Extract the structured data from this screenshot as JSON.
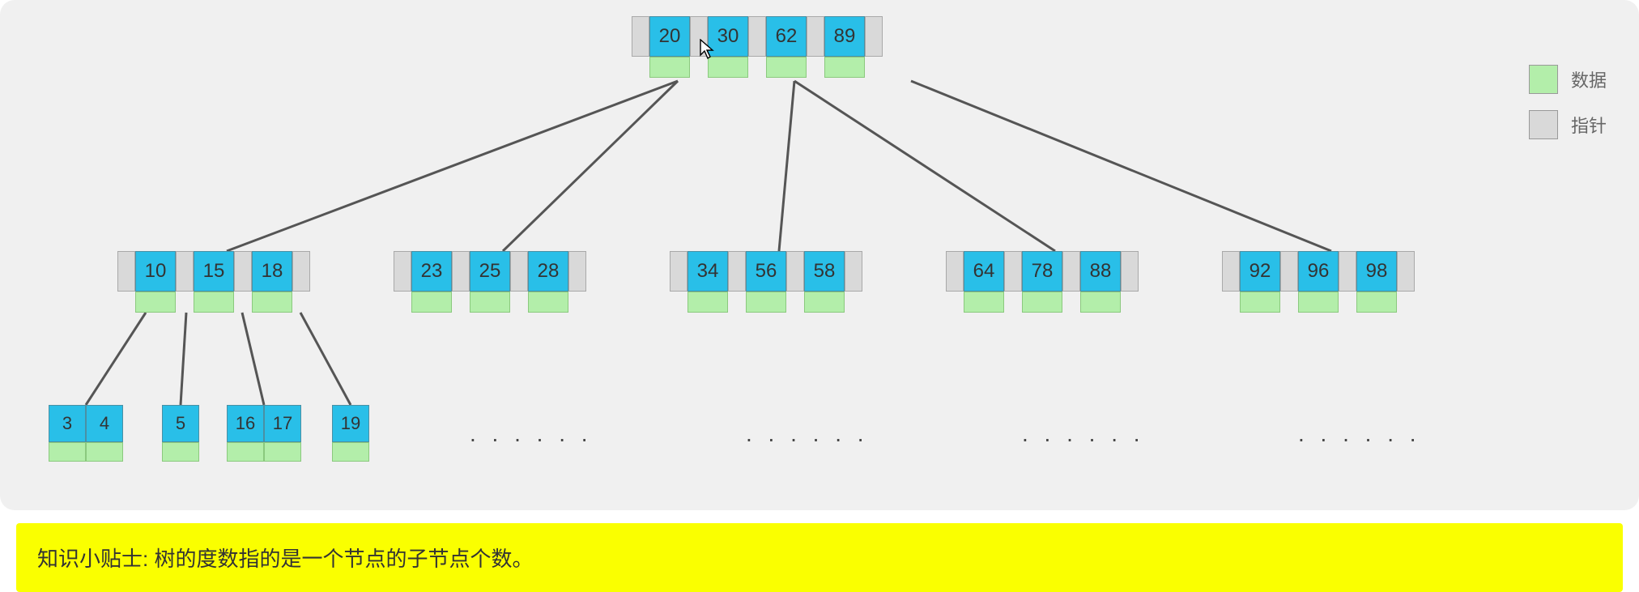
{
  "legend": {
    "data": "数据",
    "pointer": "指针"
  },
  "tip": "知识小贴士: 树的度数指的是一个节点的子节点个数。",
  "dots": ". . . . . .",
  "tree": {
    "root": [
      "20",
      "30",
      "62",
      "89"
    ],
    "level2": [
      [
        "10",
        "15",
        "18"
      ],
      [
        "23",
        "25",
        "28"
      ],
      [
        "34",
        "56",
        "58"
      ],
      [
        "64",
        "78",
        "88"
      ],
      [
        "92",
        "96",
        "98"
      ]
    ],
    "leaves_group1": [
      [
        "3",
        "4"
      ],
      [
        "5"
      ],
      [
        "16",
        "17"
      ],
      [
        "19"
      ]
    ]
  },
  "level2_x": [
    145,
    486,
    827,
    1168,
    1509
  ],
  "leaf_positions_x": [
    60,
    200,
    280,
    410
  ],
  "cursor_icon": "cursor"
}
